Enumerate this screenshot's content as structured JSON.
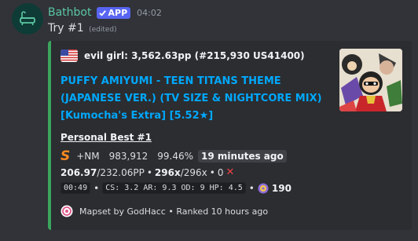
{
  "message": {
    "username": "Bathbot",
    "app_tag": "APP",
    "timestamp": "04:02",
    "content": "Try #1",
    "edited": "(edited)"
  },
  "embed": {
    "accent_color": "#3ba55d",
    "author": {
      "flag_icon": "us-flag-icon",
      "text": "evil girl: 3,562.63pp (#215,930 US41400)"
    },
    "title_lines": [
      "PUFFY AMIYUMI - TEEN TITANS THEME",
      "(JAPANESE VER.) (TV SIZE & NIGHTCORE MIX)",
      "[Kumocha's Extra] [5.52★]"
    ],
    "field": {
      "name": "Personal Best #1",
      "grade_icon": "rank-s-icon",
      "grade": "S",
      "mods": "+NM",
      "score": "983,912",
      "accuracy": "99.46%",
      "time_ago": "19 minutes ago",
      "pp": "206.97",
      "pp_max": "/232.06PP",
      "combo": "296x",
      "combo_max": "/296x",
      "misses": "0",
      "length": "00:49",
      "stats": "CS: 3.2 AR: 9.3 OD: 9 HP: 4.5",
      "bpm_icon": "bpm-icon",
      "bpm": "190"
    },
    "footer": {
      "icon": "osu-icon",
      "text": "Mapset by GodHacc • Ranked 10 hours ago"
    }
  }
}
